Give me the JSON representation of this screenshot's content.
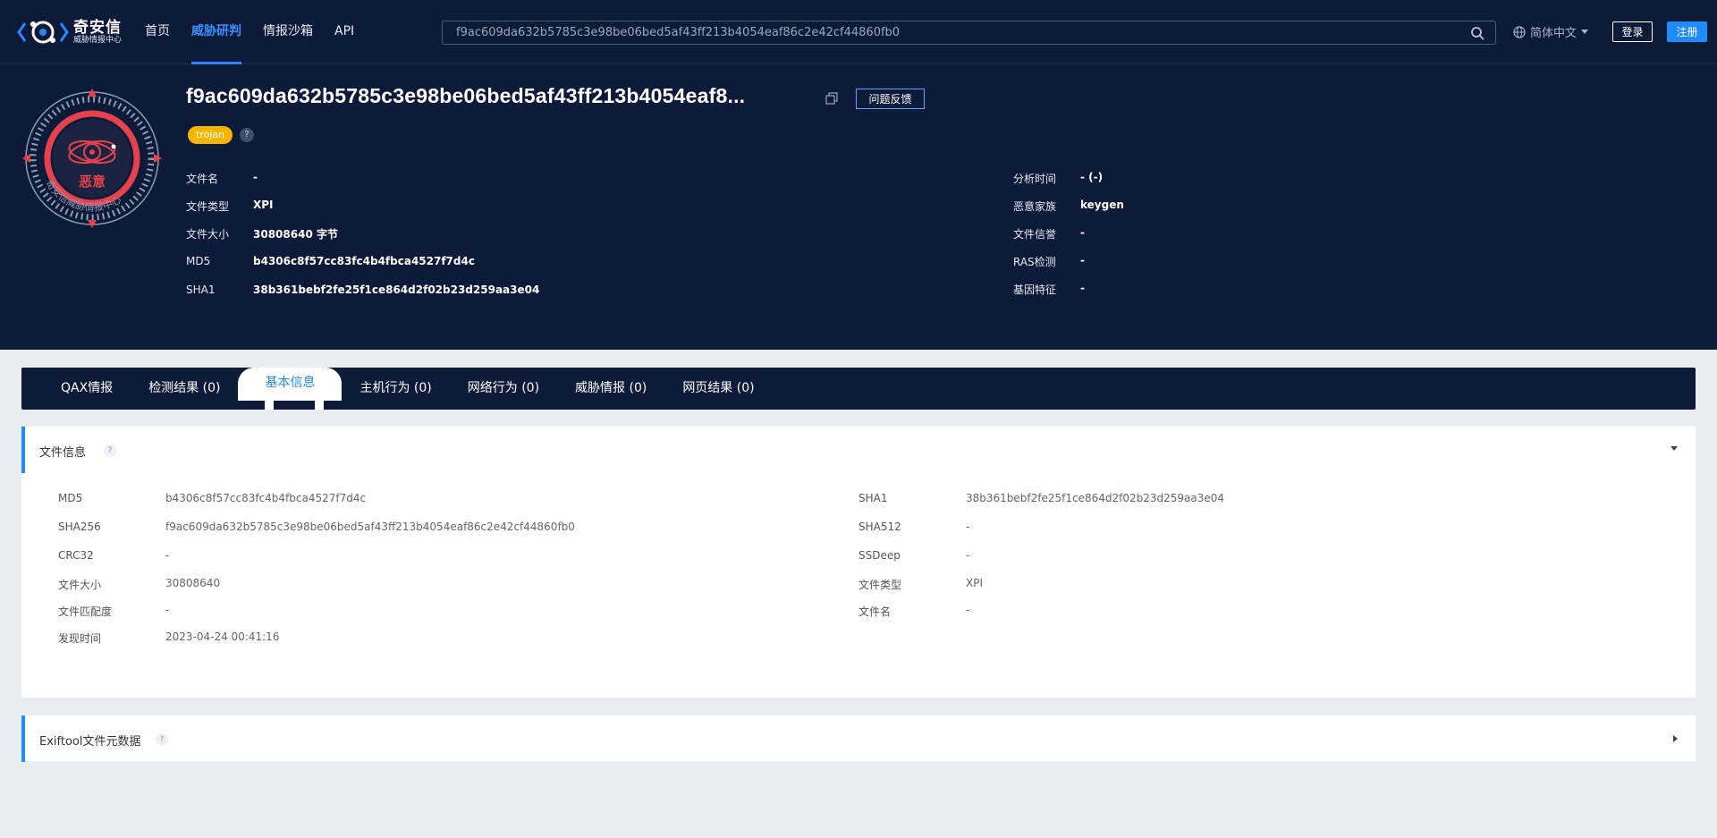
{
  "nav": {
    "logo_name": "奇安信",
    "logo_sub": "威胁情报中心",
    "items": [
      {
        "label": "首页"
      },
      {
        "label": "威胁研判"
      },
      {
        "label": "情报沙箱"
      },
      {
        "label": "API"
      }
    ],
    "search_value": "f9ac609da632b5785c3e98be06bed5af43ff213b4054eaf86c2e42cf44860fb0",
    "language": "简体中文",
    "login": "登录",
    "register": "注册",
    "accent_color": "#1e8cff",
    "bg_color": "#0d1b38"
  },
  "hero": {
    "badge_label": "恶意",
    "badge_ring_text": "奇安信威胁情报中心",
    "title": "f9ac609da632b5785c3e98be06bed5af43ff213b4054eaf8...",
    "feedback": "问题反馈",
    "tag": "trojan",
    "help": "?",
    "left_fields": [
      {
        "key": "文件名",
        "value": "-"
      },
      {
        "key": "文件类型",
        "value": "XPI"
      },
      {
        "key": "文件大小",
        "value": "30808640 字节"
      },
      {
        "key": "MD5",
        "value": "b4306c8f57cc83fc4b4fbca4527f7d4c"
      },
      {
        "key": "SHA1",
        "value": "38b361bebf2fe25f1ce864d2f02b23d259aa3e04"
      }
    ],
    "right_fields": [
      {
        "key": "分析时间",
        "value": "- (-)"
      },
      {
        "key": "恶意家族",
        "value": "keygen"
      },
      {
        "key": "文件信誉",
        "value": "-"
      },
      {
        "key": "RAS检测",
        "value": "-"
      },
      {
        "key": "基因特征",
        "value": "-"
      }
    ]
  },
  "tabs": [
    {
      "label": "QAX情报"
    },
    {
      "label": "检测结果 (0)"
    },
    {
      "label": "基本信息"
    },
    {
      "label": "主机行为 (0)"
    },
    {
      "label": "网络行为 (0)"
    },
    {
      "label": "威胁情报 (0)"
    },
    {
      "label": "网页结果 (0)"
    }
  ],
  "file_info": {
    "title": "文件信息",
    "help": "?",
    "left": [
      {
        "key": "MD5",
        "value": "b4306c8f57cc83fc4b4fbca4527f7d4c"
      },
      {
        "key": "SHA256",
        "value": "f9ac609da632b5785c3e98be06bed5af43ff213b4054eaf86c2e42cf44860fb0"
      },
      {
        "key": "CRC32",
        "value": "-"
      },
      {
        "key": "文件大小",
        "value": "30808640"
      },
      {
        "key": "文件匹配度",
        "value": "-"
      },
      {
        "key": "发现时间",
        "value": "2023-04-24 00:41:16"
      }
    ],
    "right": [
      {
        "key": "SHA1",
        "value": "38b361bebf2fe25f1ce864d2f02b23d259aa3e04"
      },
      {
        "key": "SHA512",
        "value": "-"
      },
      {
        "key": "SSDeep",
        "value": "-"
      },
      {
        "key": "文件类型",
        "value": "XPI"
      },
      {
        "key": "文件名",
        "value": "-"
      }
    ]
  },
  "exif": {
    "title": "Exiftool文件元数据",
    "help": "?"
  }
}
